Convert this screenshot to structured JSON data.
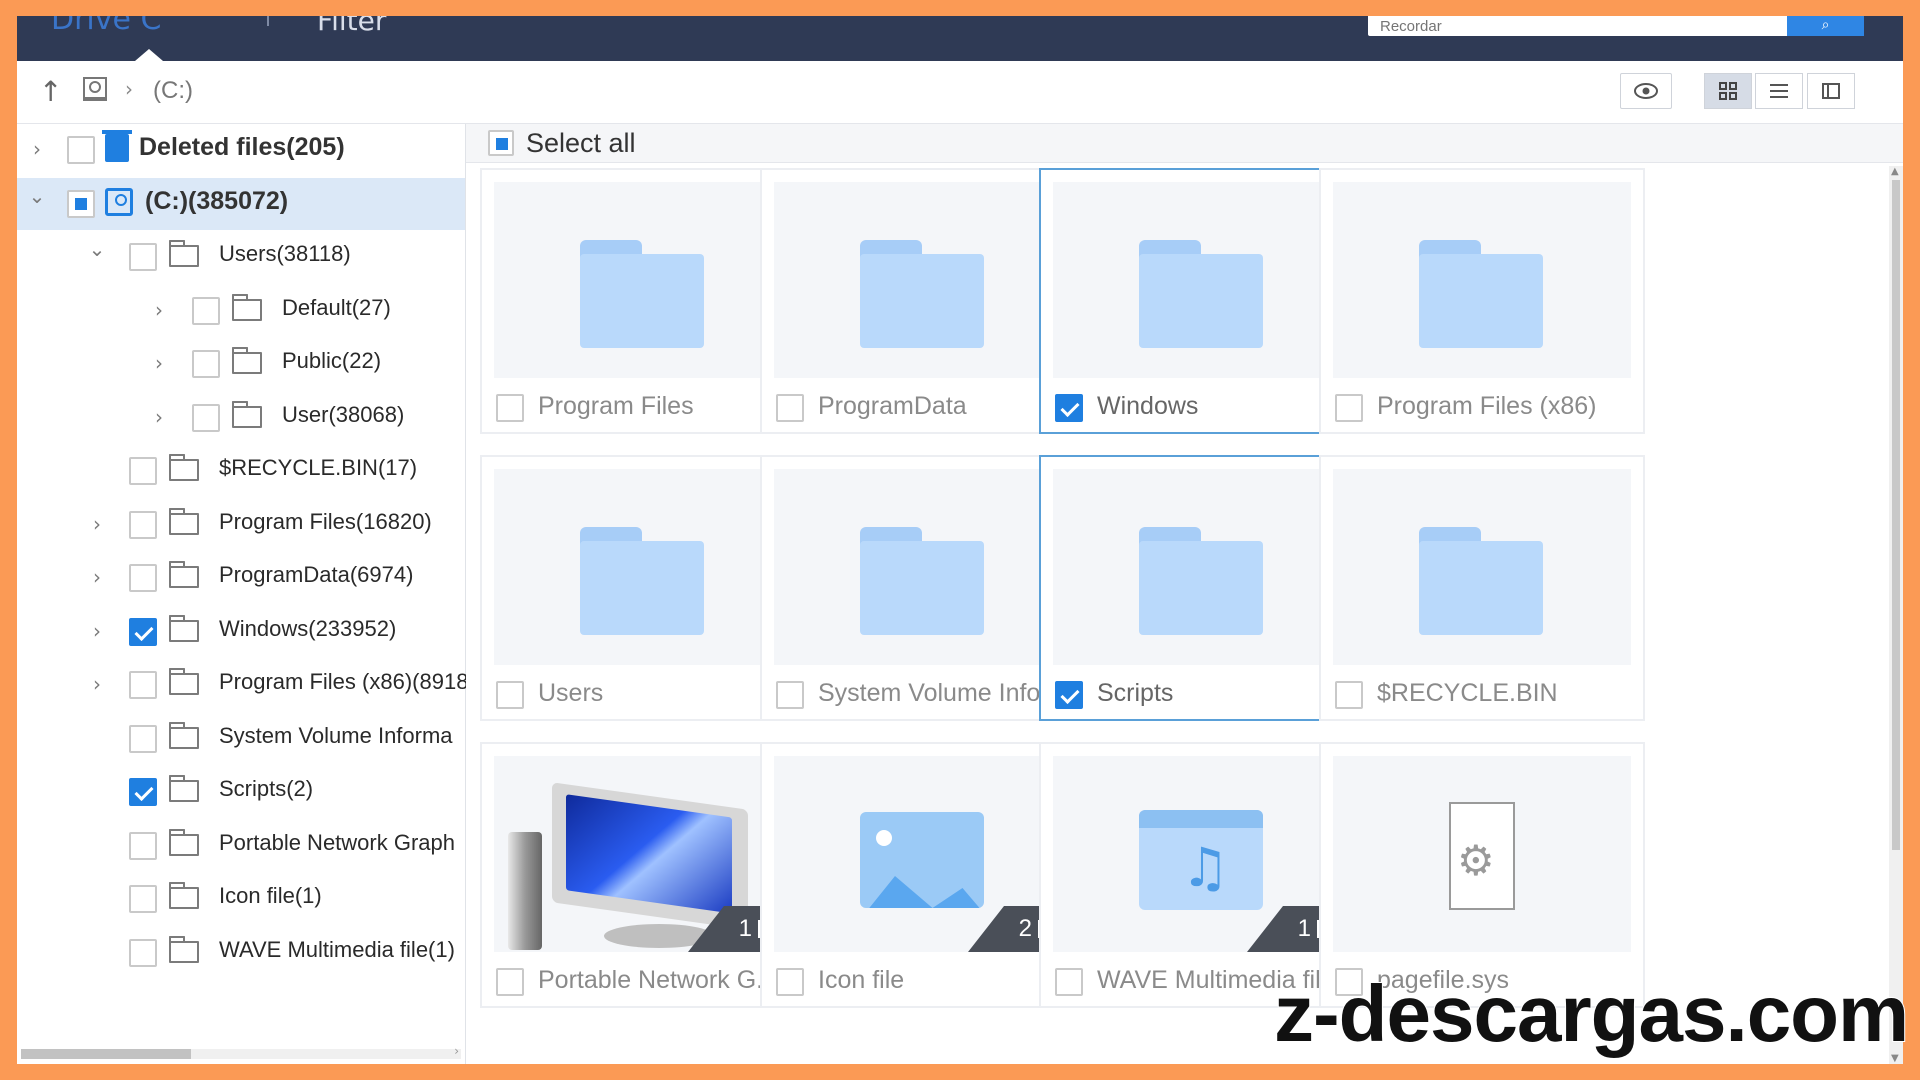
{
  "topbar": {
    "left_label": "Drive C",
    "filter_label": "Filter",
    "search_placeholder": "Recordar",
    "search_icon": "search-icon"
  },
  "toolbar": {
    "path": "(C:)",
    "view_modes": [
      "preview-eye-icon",
      "grid-view-icon",
      "list-view-icon",
      "preview-pane-icon"
    ],
    "active_view": "grid-view-icon"
  },
  "sidebar": {
    "items": [
      {
        "label": "Deleted files(205)",
        "level": 0,
        "arrow": "›",
        "checked": false,
        "bold": true,
        "icon": "trash-icon"
      },
      {
        "label": "(C:)(385072)",
        "level": 0,
        "arrow": "⌄",
        "checked": "partial",
        "bold": true,
        "icon": "disk-icon",
        "selected": true
      },
      {
        "label": "Users(38118)",
        "level": 1,
        "arrow": "⌄",
        "checked": false
      },
      {
        "label": "Default(27)",
        "level": 2,
        "arrow": "›",
        "checked": false
      },
      {
        "label": "Public(22)",
        "level": 2,
        "arrow": "›",
        "checked": false
      },
      {
        "label": "User(38068)",
        "level": 2,
        "arrow": "›",
        "checked": false
      },
      {
        "label": "$RECYCLE.BIN(17)",
        "level": 1,
        "arrow": "",
        "checked": false
      },
      {
        "label": "Program Files(16820)",
        "level": 1,
        "arrow": "›",
        "checked": false
      },
      {
        "label": "ProgramData(6974)",
        "level": 1,
        "arrow": "›",
        "checked": false
      },
      {
        "label": "Windows(233952)",
        "level": 1,
        "arrow": "›",
        "checked": true
      },
      {
        "label": "Program Files (x86)(8918",
        "level": 1,
        "arrow": "›",
        "checked": false
      },
      {
        "label": "System Volume Informa",
        "level": 1,
        "arrow": "",
        "checked": false
      },
      {
        "label": "Scripts(2)",
        "level": 1,
        "arrow": "",
        "checked": true
      },
      {
        "label": "Portable Network Graph",
        "level": 1,
        "arrow": "",
        "checked": false
      },
      {
        "label": "Icon file(1)",
        "level": 1,
        "arrow": "",
        "checked": false
      },
      {
        "label": "WAVE Multimedia file(1)",
        "level": 1,
        "arrow": "",
        "checked": false
      }
    ]
  },
  "content": {
    "select_all_label": "Select all",
    "cards": [
      {
        "name": "Program Files",
        "type": "folder",
        "checked": false
      },
      {
        "name": "ProgramData",
        "type": "folder",
        "checked": false
      },
      {
        "name": "Windows",
        "type": "folder",
        "checked": true
      },
      {
        "name": "Program Files (x86)",
        "type": "folder",
        "checked": false
      },
      {
        "name": "Users",
        "type": "folder",
        "checked": false
      },
      {
        "name": "System Volume Info...",
        "type": "folder",
        "checked": false
      },
      {
        "name": "Scripts",
        "type": "folder",
        "checked": true
      },
      {
        "name": "$RECYCLE.BIN",
        "type": "folder",
        "checked": false
      },
      {
        "name": "Portable Network G...",
        "type": "computer",
        "checked": false,
        "count": "1"
      },
      {
        "name": "Icon file",
        "type": "image",
        "checked": false,
        "count": "2"
      },
      {
        "name": "WAVE Multimedia file",
        "type": "music",
        "checked": false,
        "count": "1"
      },
      {
        "name": "pagefile.sys",
        "type": "sysfile",
        "checked": false
      }
    ]
  },
  "watermark": "z-descargas.com",
  "colors": {
    "border_frame": "#fb9a55",
    "topbar": "#2f3a55",
    "accent": "#1f7fe0",
    "selected_row": "#dbe8f7"
  }
}
